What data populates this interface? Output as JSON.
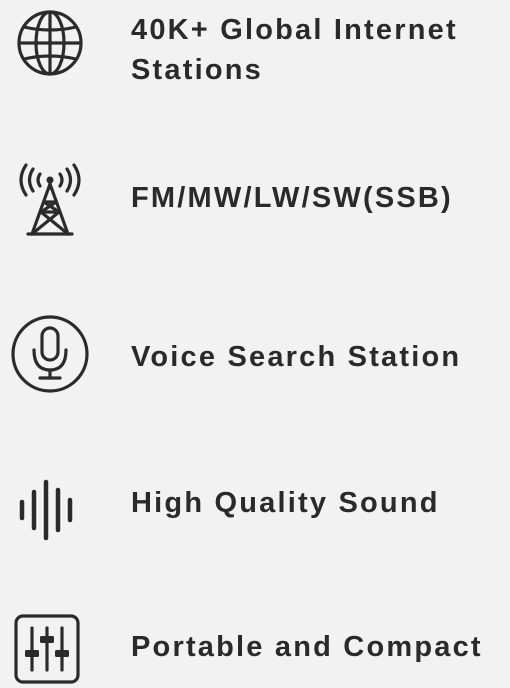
{
  "features": [
    {
      "icon": "globe-icon",
      "lines": [
        "40K+ Global Internet",
        "Stations"
      ]
    },
    {
      "icon": "radio-tower-icon",
      "lines": [
        "FM/MW/LW/SW(SSB)"
      ]
    },
    {
      "icon": "microphone-icon",
      "lines": [
        "Voice Search Station"
      ]
    },
    {
      "icon": "sound-wave-icon",
      "lines": [
        "High Quality Sound"
      ]
    },
    {
      "icon": "equalizer-sliders-icon",
      "lines": [
        "Portable and Compact"
      ]
    }
  ],
  "colors": {
    "background": "#f2f2f2",
    "text": "#2a2a2a",
    "icon": "#2b2b2b"
  }
}
